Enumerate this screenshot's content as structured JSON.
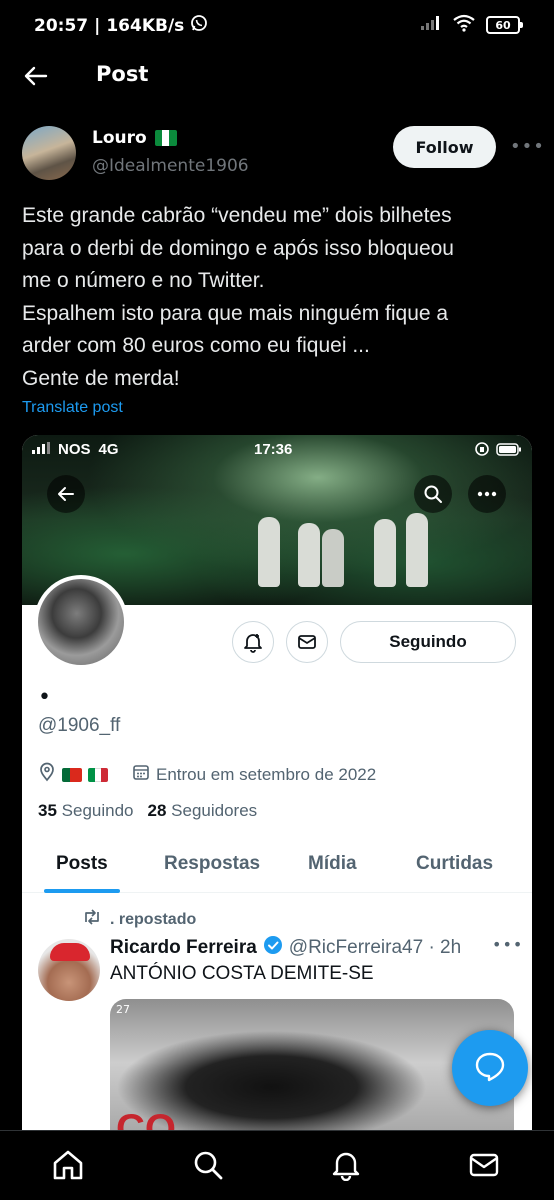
{
  "status_bar": {
    "time": "20:57",
    "separator": "|",
    "speed": "164KB/s",
    "battery": "60"
  },
  "header": {
    "title": "Post"
  },
  "author": {
    "name": "Louro",
    "handle": "@Idealmente1906",
    "follow_label": "Follow",
    "more_label": "•••"
  },
  "post": {
    "lines": [
      "Este grande cabrão “vendeu me” dois bilhetes",
      "para o derbi de domingo e após isso bloqueou",
      "me o número e no Twitter.",
      "Espalhem isto para que mais ninguém fique a",
      "arder com 80 euros como eu fiquei ...",
      "Gente de merda!"
    ],
    "translate_label": "Translate post"
  },
  "embedded": {
    "status": {
      "carrier": "NOS",
      "network": "4G",
      "time": "17:36"
    },
    "seguindo_label": "Seguindo",
    "display_name": "•",
    "handle": "@1906_ff",
    "joined": "Entrou em setembro de 2022",
    "following_count": "35",
    "following_label": "Seguindo",
    "followers_count": "28",
    "followers_label": "Seguidores",
    "tabs": [
      "Posts",
      "Respostas",
      "Mídia",
      "Curtidas"
    ],
    "repost_label": ". repostado",
    "reposted": {
      "name": "Ricardo Ferreira",
      "handle_time": "@RicFerreira47 · 2h",
      "more_label": "•••",
      "text": "ANTÓNIO COSTA DEMITE-SE",
      "media_number": "27",
      "media_text": "CO"
    }
  },
  "colors": {
    "accent": "#1d9bf0",
    "background": "#000000",
    "muted": "#71767b"
  },
  "icons": {
    "nav": [
      "home-icon",
      "search-icon",
      "notifications-icon",
      "messages-icon"
    ],
    "fab": "compose-message-icon"
  }
}
